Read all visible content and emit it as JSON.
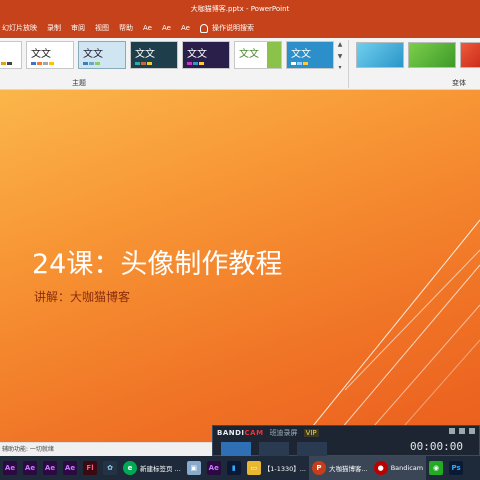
{
  "window_title": "大咖猫博客.pptx - PowerPoint",
  "menu": [
    "幻灯片放映",
    "录制",
    "审阅",
    "视图",
    "帮助",
    "Ae",
    "Ae",
    "Ae"
  ],
  "tell_me": "操作说明搜索",
  "ribbon": {
    "theme_sample_text": "文文",
    "themes_label": "主题",
    "variants_label": "变体"
  },
  "slide": {
    "title": "24课：头像制作教程",
    "subtitle": "讲解：大咖猫博客"
  },
  "status": "辅助功能: 一切就绪",
  "bandicam": {
    "logo_a": "BANDI",
    "logo_b": "CAM",
    "capture_label": "班迪录屏",
    "vip": "VIP",
    "timer": "00:00:00"
  },
  "taskbar": [
    {
      "icon": "Ae",
      "label": ""
    },
    {
      "icon": "Ae",
      "label": ""
    },
    {
      "icon": "Ae",
      "label": ""
    },
    {
      "icon": "Ae",
      "label": ""
    },
    {
      "icon": "Fl",
      "label": ""
    },
    {
      "icon": "app",
      "label": ""
    },
    {
      "icon": "edge",
      "label": "新建标签页 ..."
    },
    {
      "icon": "pic",
      "label": ""
    },
    {
      "icon": "Ae",
      "label": ""
    },
    {
      "icon": "Ps",
      "label": ""
    },
    {
      "icon": "folder",
      "label": "【1-1330】..."
    },
    {
      "icon": "ppt",
      "label": "大咖猫博客..."
    },
    {
      "icon": "rec",
      "label": "Bandicam"
    },
    {
      "icon": "wx",
      "label": ""
    },
    {
      "icon": "Ps",
      "label": ""
    }
  ],
  "colors": {
    "ribbon_bar": "#c6421a",
    "slide_orange": "#f79434",
    "taskbar": "#1e2a3a"
  }
}
